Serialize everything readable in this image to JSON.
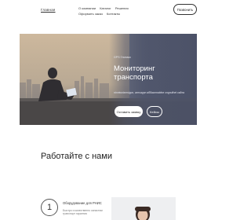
{
  "header": {
    "logo": "Главная",
    "nav": [
      "О компании",
      "Каталог",
      "Решения",
      "Оформить заказ",
      "Контакты"
    ],
    "call_button": "Позвонить"
  },
  "hero": {
    "eyebrow": "GPS Глонасс",
    "title": "Мониторинг транспорта",
    "subtitle": "ntnntwnixmsigon, антсаурн аббаагmabfne cngnufhet\nсайта",
    "primary_button": "Оставить заявку",
    "secondary_button": "Кейсы"
  },
  "section": {
    "title": "Работайте с нами",
    "step": {
      "number": "1",
      "title": "Оборудование для РНИС",
      "description": "Быстро и качественно оснастим\nтранспорт гарантия"
    }
  },
  "colors": {
    "hero_overlay": "#4f5568",
    "text": "#2b2b2b",
    "button_bg": "#ffffff"
  }
}
